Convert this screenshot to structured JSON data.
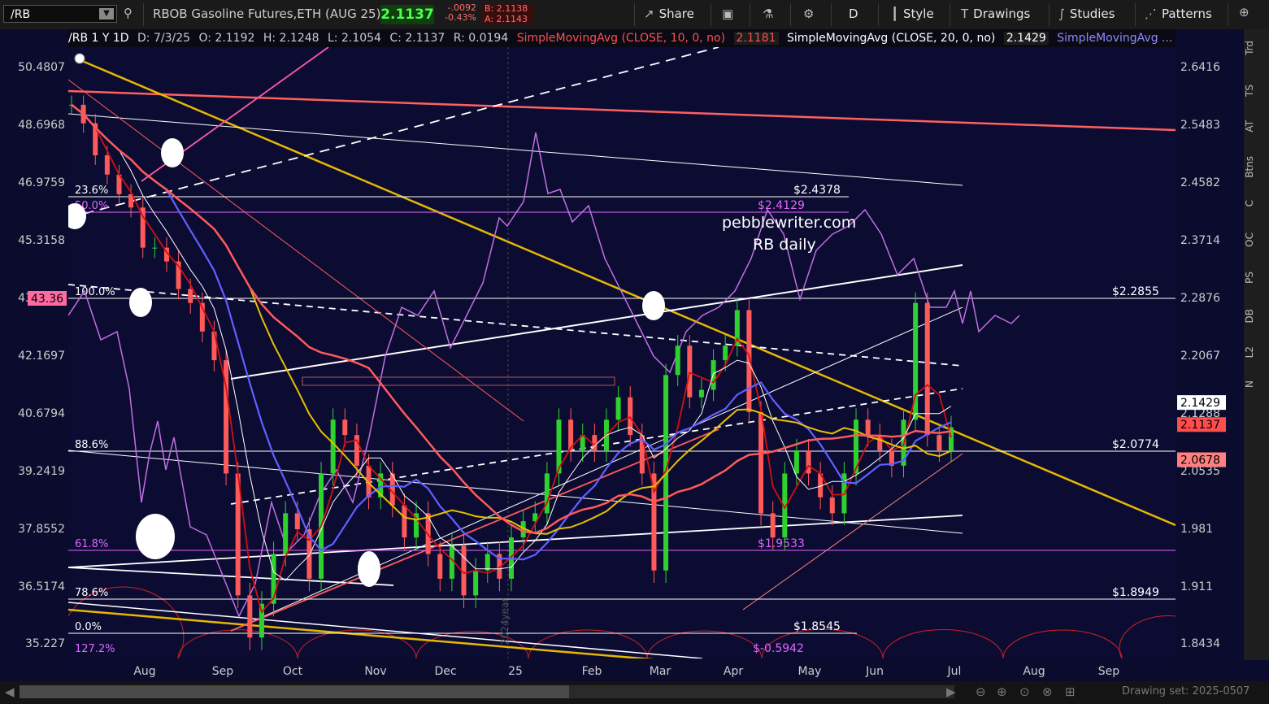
{
  "toolbar": {
    "symbol": "/RB",
    "description": "RBOB Gasoline Futures,ETH (AUG 25)",
    "last": "2.1137",
    "change": "-.0092",
    "change_pct": "-0.43%",
    "bid": "B: 2.1138",
    "ask": "A: 2.1143",
    "share": "Share",
    "period": "D",
    "style": "Style",
    "drawings": "Drawings",
    "studies": "Studies",
    "patterns": "Patterns"
  },
  "infobar": {
    "header": "/RB 1 Y 1D",
    "date": "D: 7/3/25",
    "open": "O: 2.1192",
    "high": "H: 2.1248",
    "low": "L: 2.1054",
    "close": "C: 2.1137",
    "range": "R: 0.0194",
    "sma10": "SimpleMovingAvg (CLOSE, 10, 0, no)",
    "sma10_val": "2.1181",
    "sma20": "SimpleMovingAvg (CLOSE, 20, 0, no)",
    "sma20_val": "2.1429",
    "sma_more": "SimpleMovingAvg ..."
  },
  "right_tabs": [
    "Trd",
    "TS",
    "AT",
    "Btns",
    "C",
    "OC",
    "PS",
    "DB",
    "L2",
    "N"
  ],
  "drawing_set": "Drawing set: 2025-0507",
  "chart_data": {
    "type": "candlestick",
    "title": "pebblewriter.com",
    "subtitle": "RB daily",
    "x_ticks": [
      "Aug",
      "Sep",
      "Oct",
      "Nov",
      "Dec",
      "25",
      "Feb",
      "Mar",
      "Apr",
      "May",
      "Jun",
      "Jul",
      "Aug",
      "Sep"
    ],
    "year_marker": "2024year",
    "right_ticks": [
      "2.6416",
      "2.5483",
      "2.4582",
      "2.3714",
      "2.2876",
      "2.2067",
      "2.1288",
      "2.0535",
      "1.981",
      "1.911",
      "1.8434"
    ],
    "left_ticks": [
      "50.4807",
      "48.6968",
      "46.9759",
      "45.3158",
      "43.7145",
      "42.1697",
      "40.6794",
      "39.2419",
      "37.8552",
      "36.5174",
      "35.227"
    ],
    "left_marker": "43.36",
    "ylim_price": [
      1.8434,
      2.6416
    ],
    "price_badges": [
      {
        "label": "2.1429",
        "value": 2.1429,
        "bg": "#ffffff",
        "fg": "#000000"
      },
      {
        "label": "2.1137",
        "value": 2.1137,
        "bg": "#ff4d4d",
        "fg": "#000000"
      },
      {
        "label": "2.0678",
        "value": 2.0678,
        "bg": "#ff8080",
        "fg": "#000000"
      }
    ],
    "fib_levels": [
      {
        "label": "23.6%",
        "price_label": "$2.4378",
        "value": 2.4378,
        "color": "#ffffff"
      },
      {
        "label": "50.0%",
        "price_label": "$2.4129",
        "value": 2.4129,
        "color": "#e066ff"
      },
      {
        "label": "100.0%",
        "price_label": "$2.2855",
        "value": 2.2855,
        "color": "#ffffff"
      },
      {
        "label": "88.6%",
        "price_label": "$2.0774",
        "value": 2.0774,
        "color": "#ffffff"
      },
      {
        "label": "61.8%",
        "price_label": "$1.9533",
        "value": 1.9533,
        "color": "#e066ff"
      },
      {
        "label": "78.6%",
        "price_label": "$1.8949",
        "value": 1.8949,
        "color": "#ffffff"
      },
      {
        "label": "0.0%",
        "price_label": "$1.8545",
        "value": 1.8545,
        "color": "#ffffff"
      },
      {
        "label": "127.2%",
        "price_label": "$-0.5942",
        "value": null,
        "color": "#e066ff"
      }
    ],
    "colors": {
      "background": "#0c0c33",
      "up": "#2fd12f",
      "down": "#ff5a5a",
      "sma10": "#d01010",
      "sma20": "#ffffff",
      "sma50": "#6060ff",
      "sma100": "#e6c000",
      "sma200": "#ff5a5a",
      "oscillator": "#c070e0",
      "trend_gold": "#e6b800",
      "trend_pink": "#ff5aa0"
    },
    "series": [
      {
        "name": "Price",
        "values": [
          2.58,
          2.55,
          2.5,
          2.47,
          2.44,
          2.42,
          2.36,
          2.36,
          2.34,
          2.3,
          2.28,
          2.24,
          2.2,
          2.05,
          1.9,
          1.85,
          1.89,
          1.95,
          2.0,
          1.98,
          1.92,
          2.05,
          2.12,
          2.1,
          2.06,
          2.02,
          2.05,
          2.01,
          1.97,
          2.0,
          1.95,
          1.92,
          1.96,
          1.9,
          1.93,
          1.95,
          1.92,
          1.97,
          1.99,
          2.0,
          2.05,
          2.12,
          2.08,
          2.1,
          2.08,
          2.12,
          2.15,
          2.1,
          2.05,
          1.93,
          2.18,
          2.22,
          2.15,
          2.16,
          2.2,
          2.22,
          2.27,
          2.13,
          2.0,
          1.97,
          2.05,
          2.08,
          2.05,
          2.02,
          2.0,
          2.05,
          2.12,
          2.1,
          2.08,
          2.06,
          2.12,
          2.28,
          2.1,
          2.08,
          2.11
        ]
      }
    ]
  }
}
